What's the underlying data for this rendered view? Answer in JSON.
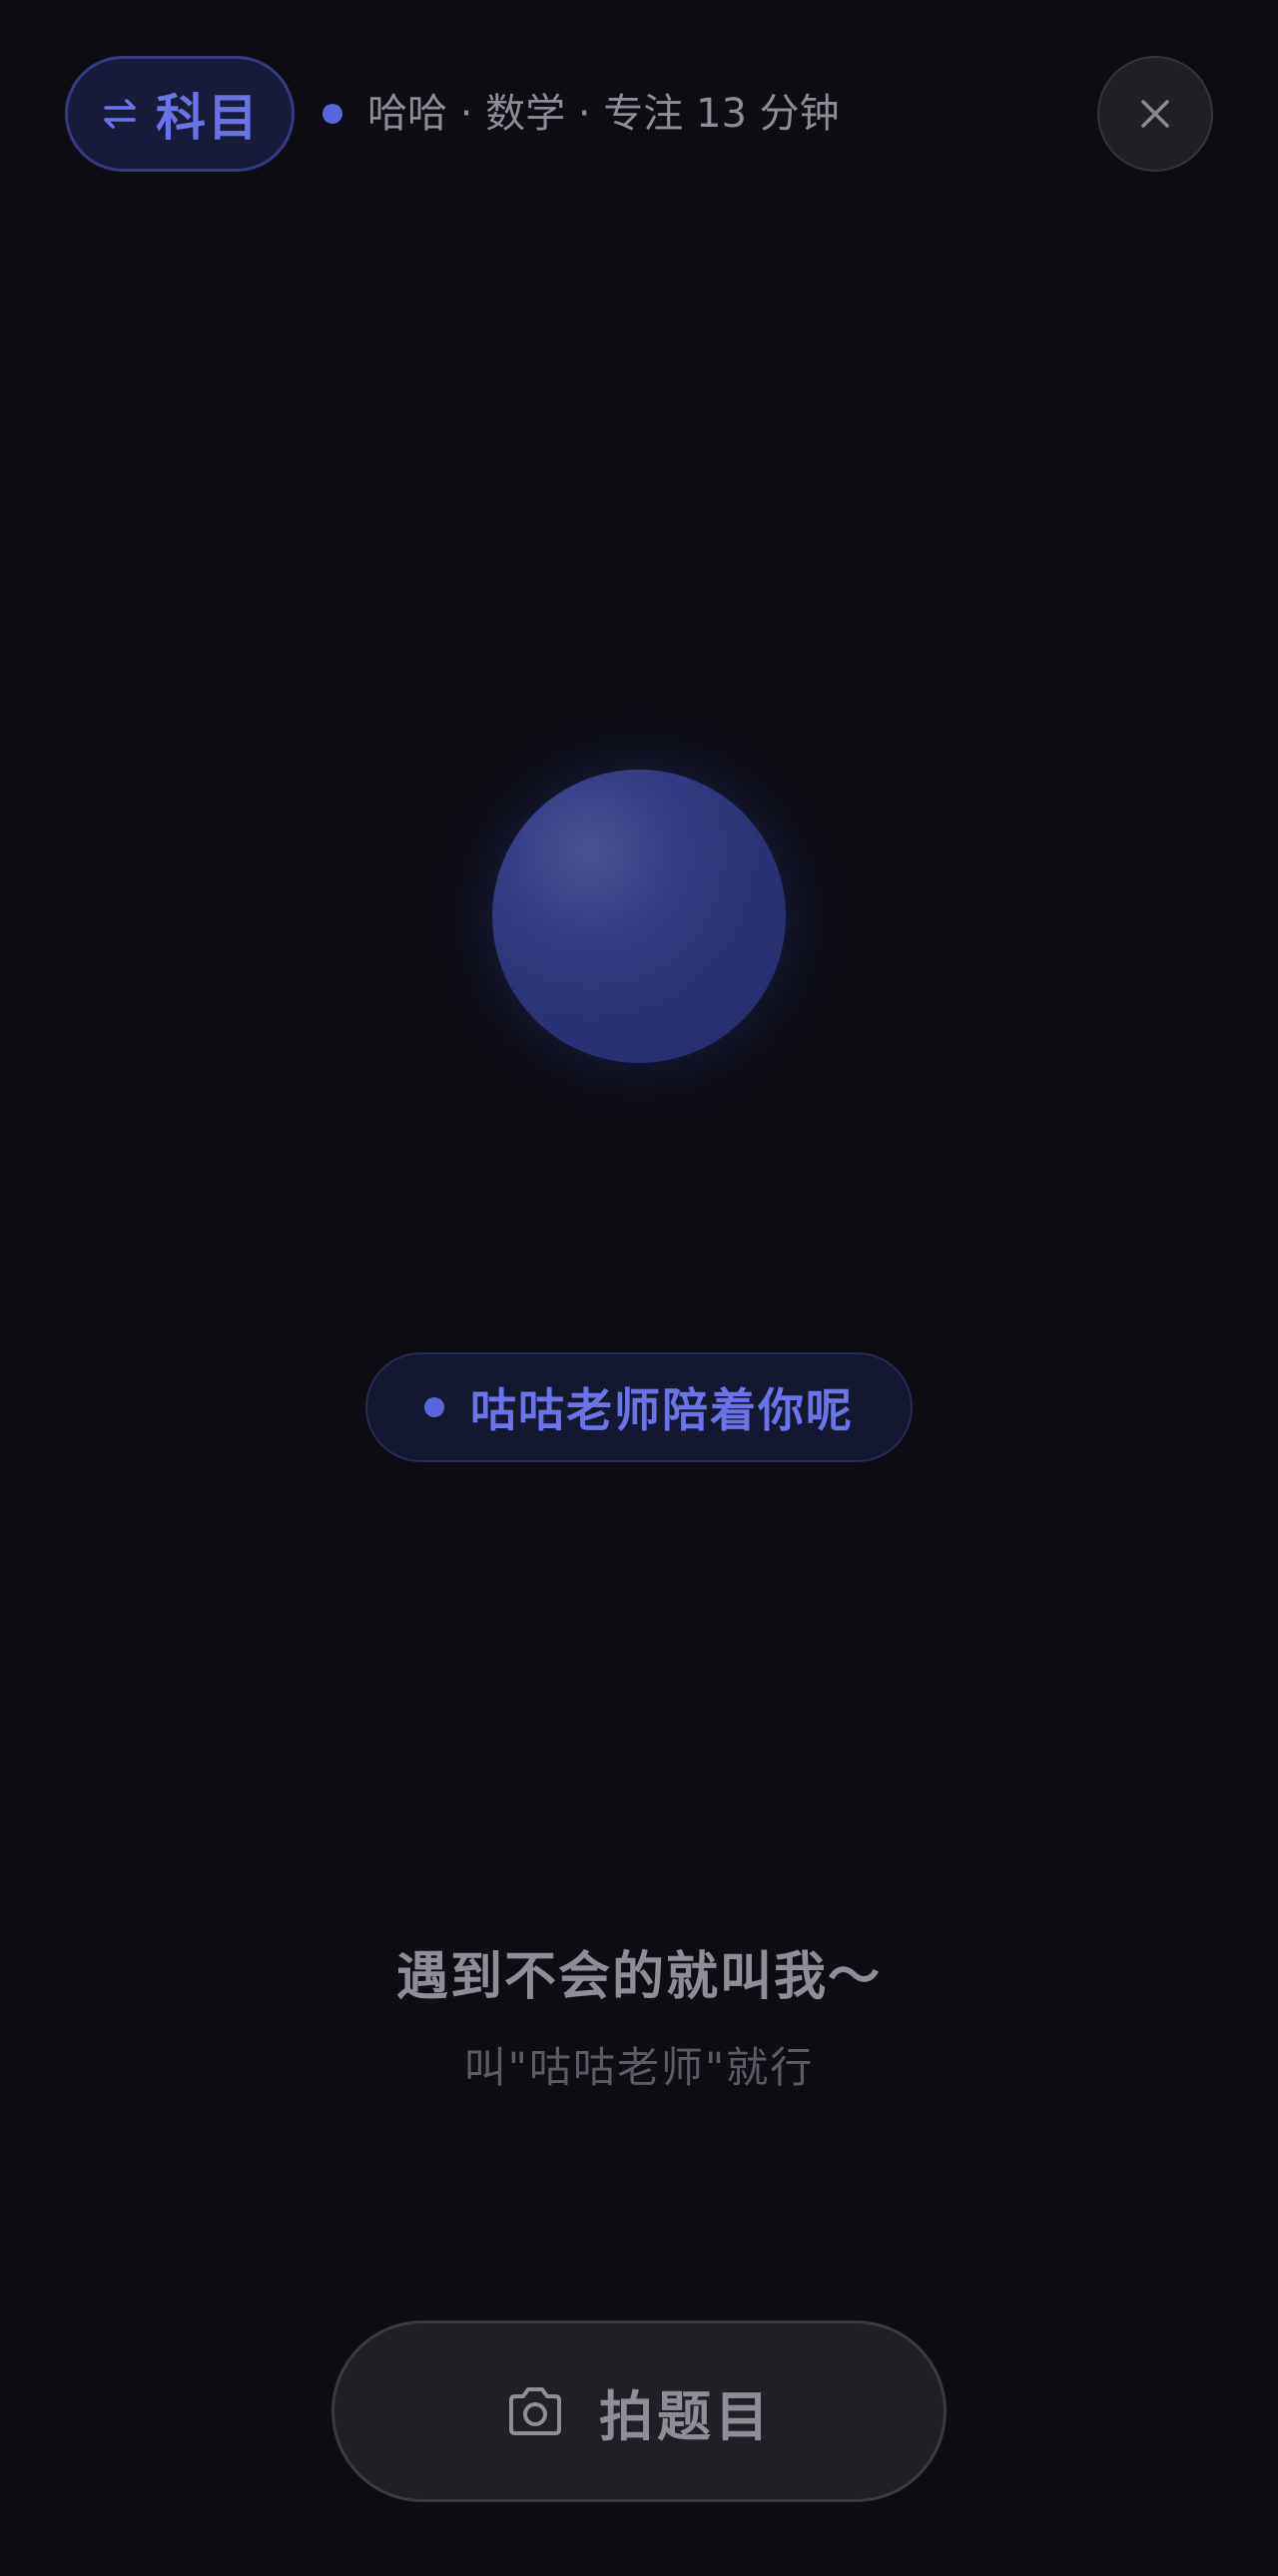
{
  "header": {
    "subject_button_label": "科目",
    "status_text": "哈哈 · 数学 · 专注 13 分钟"
  },
  "assistant": {
    "status_pill": "咕咕老师陪着你呢"
  },
  "hint": {
    "main": "遇到不会的就叫我～",
    "sub": "叫\"咕咕老师\"就行"
  },
  "actions": {
    "photo_label": "拍题目"
  },
  "icons": {
    "subject": "swap-arrows-icon",
    "close": "close-icon",
    "photo": "camera-icon"
  },
  "colors": {
    "background": "#0d0d13",
    "accent": "#6b74e6",
    "orb": "#2f3780",
    "text_secondary": "#8e8e98"
  }
}
